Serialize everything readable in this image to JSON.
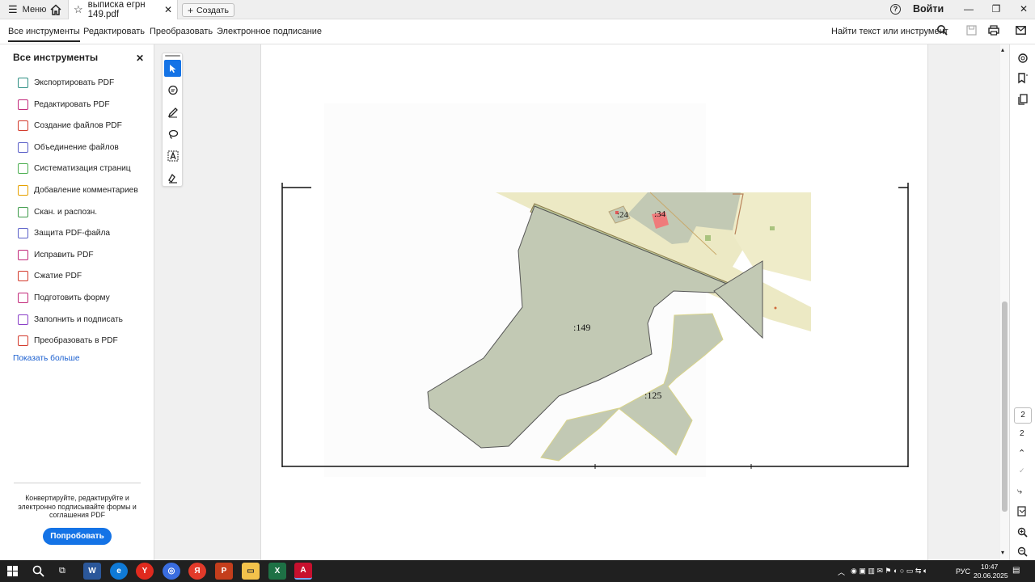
{
  "titlebar": {
    "menu_label": "Меню",
    "tab_title": "выписка егрн 149.pdf",
    "create_label": "Создать",
    "signin_label": "Войти"
  },
  "toolbar": {
    "tabs": [
      "Все инструменты",
      "Редактировать",
      "Преобразовать",
      "Электронное подписание"
    ],
    "find_label": "Найти текст или инструмент"
  },
  "left_panel": {
    "title": "Все инструменты",
    "tools": [
      {
        "label": "Экспортировать PDF",
        "color": "#2e8f83"
      },
      {
        "label": "Редактировать PDF",
        "color": "#c2287a"
      },
      {
        "label": "Создание файлов PDF",
        "color": "#d33a2c"
      },
      {
        "label": "Объединение файлов",
        "color": "#5a5fc8"
      },
      {
        "label": "Систематизация страниц",
        "color": "#4caf50"
      },
      {
        "label": "Добавление комментариев",
        "color": "#e6a100"
      },
      {
        "label": "Скан. и распозн.",
        "color": "#3c9a48"
      },
      {
        "label": "Защита PDF-файла",
        "color": "#5a5fc8"
      },
      {
        "label": "Исправить PDF",
        "color": "#c2287a"
      },
      {
        "label": "Сжатие PDF",
        "color": "#d33a2c"
      },
      {
        "label": "Подготовить форму",
        "color": "#c2287a"
      },
      {
        "label": "Заполнить и подписать",
        "color": "#8a3fc8"
      },
      {
        "label": "Преобразовать в PDF",
        "color": "#d33a2c"
      }
    ],
    "show_more": "Показать больше",
    "promo_text": "Конвертируйте, редактируйте и электронно подписывайте формы и соглашения PDF",
    "try_button": "Попробовать"
  },
  "map": {
    "labels": [
      ":24",
      ":34",
      ":149",
      ":125"
    ],
    "parcel_fill": "#c2c9b4",
    "zone_fill": "#ece9c4"
  },
  "page_indicator": {
    "current": "2",
    "total": "2"
  },
  "taskbar": {
    "lang": "РУС",
    "time": "10:47",
    "date": "20.06.2025"
  }
}
